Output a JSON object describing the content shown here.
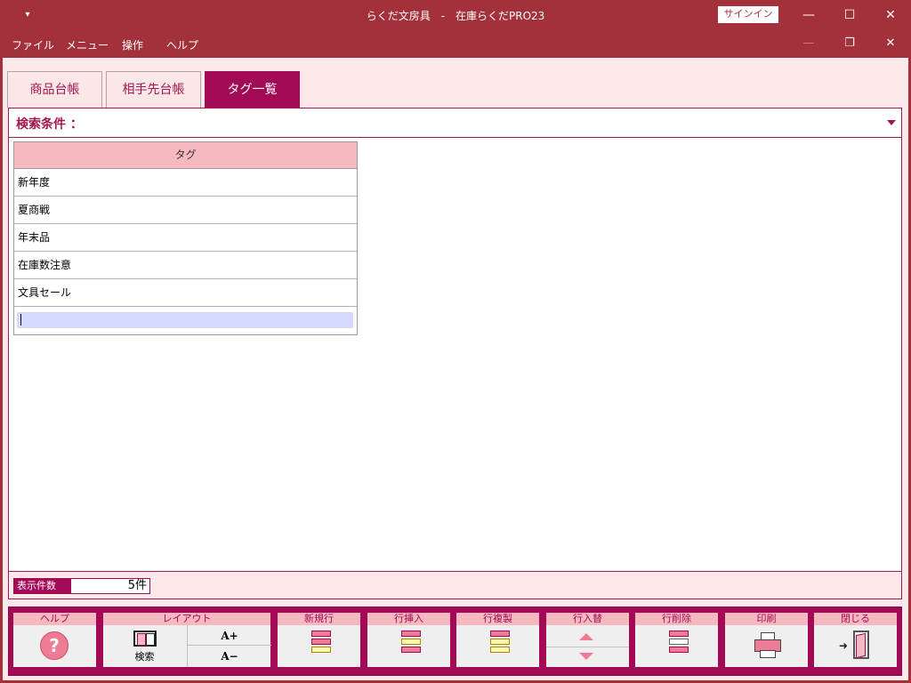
{
  "window": {
    "title": "らくだ文房具　-　在庫らくだPRO23",
    "quick_access": "▾",
    "signin_label": "サインイン"
  },
  "menu": [
    "ファイル",
    "メニュー",
    "操作",
    "ヘルプ"
  ],
  "tabs": [
    {
      "label": "商品台帳",
      "active": false
    },
    {
      "label": "相手先台帳",
      "active": false
    },
    {
      "label": "タグ一覧",
      "active": true
    }
  ],
  "search": {
    "label": "検索条件 ："
  },
  "grid": {
    "header": "タグ",
    "rows": [
      "新年度",
      "夏商戦",
      "年末品",
      "在庫数注意",
      "文具セール"
    ],
    "edit_value": ""
  },
  "status": {
    "count_label": "表示件数",
    "count_value": "5件"
  },
  "toolbar": {
    "help": "ヘルプ",
    "layout": "レイアウト",
    "layout_search": "検索",
    "font_up": "A+",
    "font_down": "A−",
    "new_row": "新規行",
    "insert_row": "行挿入",
    "copy_row": "行複製",
    "swap_row": "行入替",
    "delete_row": "行削除",
    "print": "印刷",
    "close": "閉じる"
  },
  "colors": {
    "frame": "#a3313c",
    "accent": "#a30a56",
    "pink_light": "#fde9ea",
    "pink_header": "#f7b9c0",
    "edit_highlight": "#d6d9ff"
  }
}
